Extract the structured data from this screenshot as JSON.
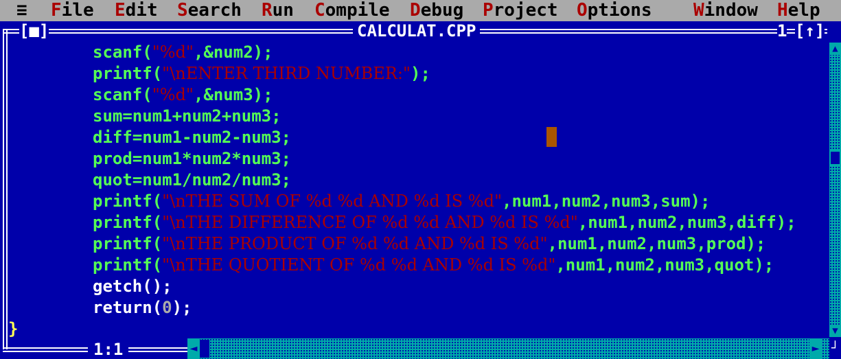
{
  "menu": {
    "system": "≡",
    "items": [
      {
        "hot": "F",
        "rest": "ile"
      },
      {
        "hot": "E",
        "rest": "dit"
      },
      {
        "hot": "S",
        "rest": "earch"
      },
      {
        "hot": "R",
        "rest": "un"
      },
      {
        "hot": "C",
        "rest": "ompile"
      },
      {
        "hot": "D",
        "rest": "ebug"
      },
      {
        "hot": "P",
        "rest": "roject"
      },
      {
        "hot": "O",
        "rest": "ptions"
      },
      {
        "hot": "W",
        "rest": "indow"
      },
      {
        "hot": "H",
        "rest": "elp"
      }
    ]
  },
  "window": {
    "close_box": "[■]",
    "title": "CALCULAT.CPP",
    "number": "1",
    "zoom_box": "[↑]",
    "position": "1:1"
  },
  "code_lines": [
    [
      {
        "t": "scanf(",
        "c": "kw"
      },
      {
        "t": "\"%d\"",
        "c": "str"
      },
      {
        "t": ",&num2);",
        "c": "kw"
      }
    ],
    [
      {
        "t": "printf(",
        "c": "kw"
      },
      {
        "t": "\"\\nENTER THIRD NUMBER:\"",
        "c": "str"
      },
      {
        "t": ");",
        "c": "kw"
      }
    ],
    [
      {
        "t": "scanf(",
        "c": "kw"
      },
      {
        "t": "\"%d\"",
        "c": "str"
      },
      {
        "t": ",&num3);",
        "c": "kw"
      }
    ],
    [
      {
        "t": "sum=num1+num2+num3;",
        "c": "id"
      }
    ],
    [
      {
        "t": "diff=num1-num2-num3;",
        "c": "id"
      }
    ],
    [
      {
        "t": "prod=num1*num2*num3;",
        "c": "id"
      }
    ],
    [
      {
        "t": "quot=num1/num2/num3;",
        "c": "id"
      }
    ],
    [
      {
        "t": "printf(",
        "c": "kw"
      },
      {
        "t": "\"\\nTHE SUM OF %d %d AND %d IS %d\"",
        "c": "str"
      },
      {
        "t": ",num1,num2,num3,sum);",
        "c": "kw"
      }
    ],
    [
      {
        "t": "printf(",
        "c": "kw"
      },
      {
        "t": "\"\\nTHE DIFFERENCE OF %d %d AND %d IS %d\"",
        "c": "str"
      },
      {
        "t": ",num1,num2,num3,diff);",
        "c": "kw"
      }
    ],
    [
      {
        "t": "printf(",
        "c": "kw"
      },
      {
        "t": "\"\\nTHE PRODUCT OF %d %d AND %d IS %d\"",
        "c": "str"
      },
      {
        "t": ",num1,num2,num3,prod);",
        "c": "kw"
      }
    ],
    [
      {
        "t": "printf(",
        "c": "kw"
      },
      {
        "t": "\"\\nTHE QUOTIENT OF %d %d AND %d IS %d\"",
        "c": "str"
      },
      {
        "t": ",num1,num2,num3,quot);",
        "c": "kw"
      }
    ],
    [
      {
        "t": "getch();",
        "c": "kw"
      }
    ],
    [
      {
        "t": "return(",
        "c": "kw"
      },
      {
        "t": "0",
        "c": "num"
      },
      {
        "t": ");",
        "c": "kw"
      }
    ],
    [
      {
        "t": "}",
        "c": "kw"
      }
    ]
  ],
  "colors": {
    "background": "#0000aa",
    "menubar": "#aaaaaa",
    "hotkey": "#aa0000",
    "identifier": "#55ff55",
    "keyword": "#ffffff",
    "string": "#aa0000",
    "number": "#aaaaaa",
    "cursor": "#aa5500",
    "scrollbar": "#00aaaa"
  }
}
